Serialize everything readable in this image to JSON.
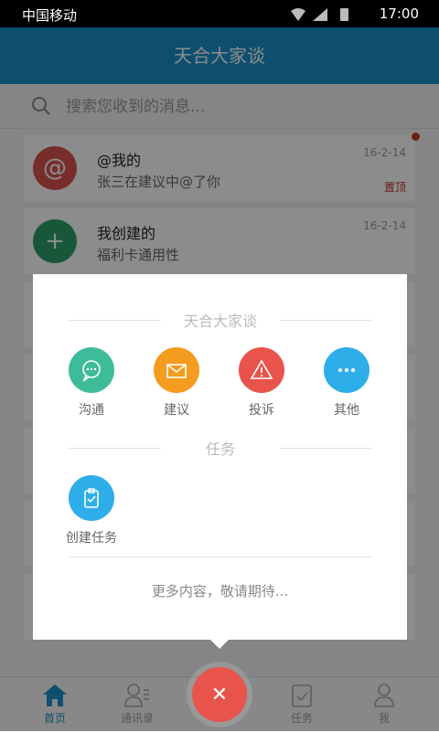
{
  "status_bar": {
    "carrier": "中国移动",
    "time": "17:00"
  },
  "header": {
    "title": "天合大家谈"
  },
  "search": {
    "placeholder": "搜索您收到的消息..."
  },
  "messages": [
    {
      "title": "@我的",
      "subtitle": "张三在建议中@了你",
      "date": "16-2-14",
      "badge": "置顶",
      "icon": "at-icon",
      "color": "#d9534f"
    },
    {
      "title": "我创建的",
      "subtitle": "福利卡通用性",
      "date": "16-2-14",
      "icon": "plus-icon",
      "color": "#2e9e6b"
    }
  ],
  "tabs": [
    {
      "label": "首页",
      "icon": "home-icon",
      "active": true
    },
    {
      "label": "通讯录",
      "icon": "contacts-icon"
    },
    {
      "label": "任务",
      "icon": "task-icon"
    },
    {
      "label": "我",
      "icon": "person-icon"
    }
  ],
  "menu": {
    "section_main": "天合大家谈",
    "section_task": "任务",
    "items_main": [
      {
        "label": "沟通",
        "icon": "chat-icon",
        "color": "#3ebc9a"
      },
      {
        "label": "建议",
        "icon": "mail-icon",
        "color": "#f39c1f"
      },
      {
        "label": "投诉",
        "icon": "warning-icon",
        "color": "#e8544c"
      },
      {
        "label": "其他",
        "icon": "more-icon",
        "color": "#2eaee8"
      }
    ],
    "items_task": [
      {
        "label": "创建任务",
        "icon": "clipboard-icon",
        "color": "#2eaee8"
      }
    ],
    "footer": "更多内容，敬请期待..."
  },
  "fab": {
    "icon": "close-icon",
    "color": "#e8544c"
  },
  "colors": {
    "accent": "#1a8fcb",
    "red": "#c0392b"
  }
}
